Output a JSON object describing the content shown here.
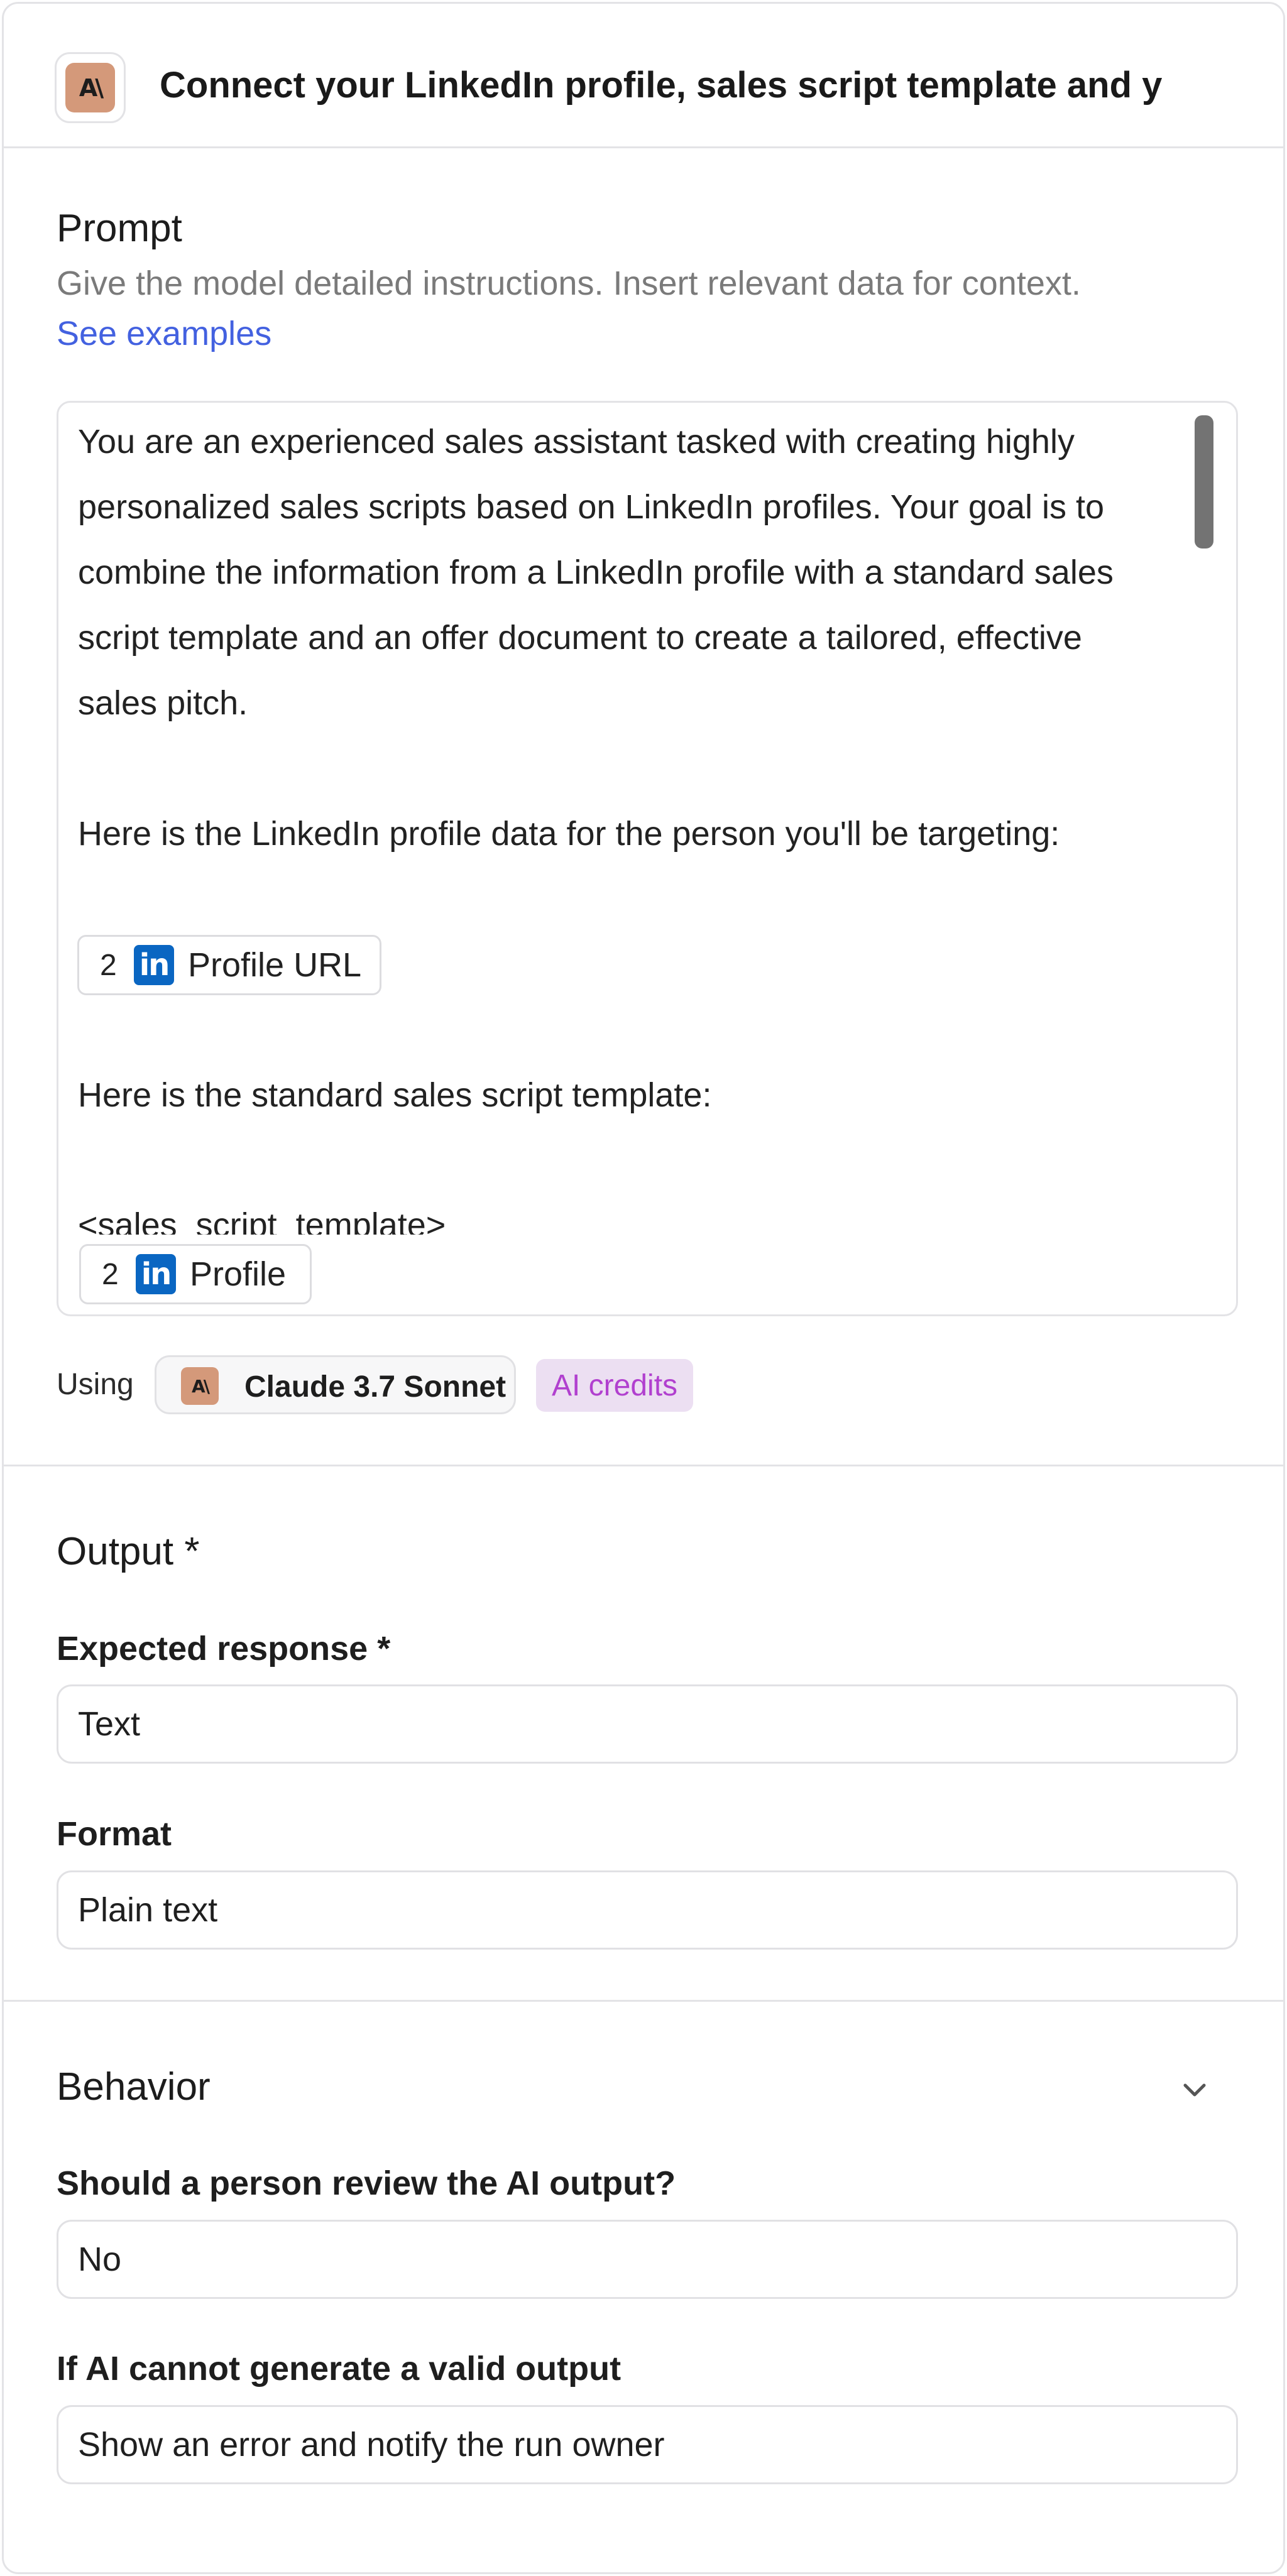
{
  "header": {
    "title": "Connect your LinkedIn profile, sales script template and y",
    "logo_text": "A\\"
  },
  "prompt": {
    "title": "Prompt",
    "description": "Give the model detailed instructions. Insert relevant data for context.",
    "examples_link": "See examples",
    "lines": [
      "You are an experienced sales assistant tasked with creating highly",
      "personalized sales scripts based on LinkedIn profiles. Your goal is to",
      "combine the information from a LinkedIn profile with a standard sales",
      "script template and an offer document to create a tailored, effective",
      "sales pitch.",
      "Here is the LinkedIn profile data for the person you'll be targeting:",
      "Here is the standard sales script template:",
      "<sales_script_template>"
    ],
    "chips": [
      {
        "number": "2",
        "icon": "linkedin-icon",
        "label": "Profile URL"
      },
      {
        "number": "2",
        "icon": "linkedin-icon",
        "label": "Profile"
      }
    ]
  },
  "model": {
    "using_label": "Using",
    "name": "Claude 3.7 Sonnet",
    "logo_text": "A\\",
    "credits_label": "AI credits"
  },
  "output": {
    "title": "Output *",
    "expected_label": "Expected response *",
    "expected_value": "Text",
    "format_label": "Format",
    "format_value": "Plain text"
  },
  "behavior": {
    "title": "Behavior",
    "review_label": "Should a person review the AI output?",
    "review_value": "No",
    "fallback_label": "If AI cannot generate a valid output",
    "fallback_value": "Show an error and notify the run owner"
  },
  "colors": {
    "accent_link": "#4361e0",
    "anthropic_badge": "#d4997a",
    "linkedin": "#0a66c2",
    "credits_bg": "#ecdff2",
    "credits_text": "#b140cf"
  }
}
